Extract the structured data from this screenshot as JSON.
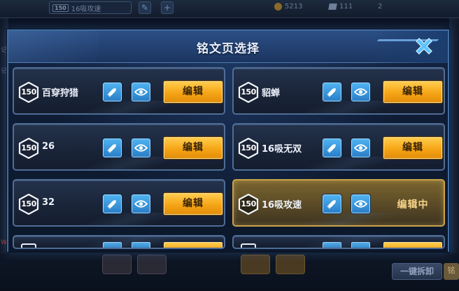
{
  "background": {
    "page_chip": {
      "level": "150",
      "name": "16吸攻速"
    },
    "stats": {
      "gold": "5213",
      "gems": "111",
      "other": "2"
    },
    "bottom_button": "一键拆卸",
    "bottom_tail": "铭",
    "left_glyphs": [
      "记",
      "记",
      "W"
    ]
  },
  "modal": {
    "title": "铭文页选择",
    "close_icon": "close-x-icon"
  },
  "rune_pages": [
    {
      "level": "150",
      "name": "百穿狩猎",
      "action": "编辑",
      "active": false
    },
    {
      "level": "150",
      "name": "貂蝉",
      "action": "编辑",
      "active": false
    },
    {
      "level": "150",
      "name": "26",
      "action": "编辑",
      "active": false
    },
    {
      "level": "150",
      "name": "16吸无双",
      "action": "编辑",
      "active": false
    },
    {
      "level": "150",
      "name": "32",
      "action": "编辑",
      "active": false
    },
    {
      "level": "150",
      "name": "16吸攻速",
      "action": "编辑中",
      "active": true
    }
  ],
  "colors": {
    "edit_button": "#f5a516",
    "icon_button": "#2b7fc7",
    "active_card": "#5a4a26",
    "frame": "#3f6ea3"
  }
}
